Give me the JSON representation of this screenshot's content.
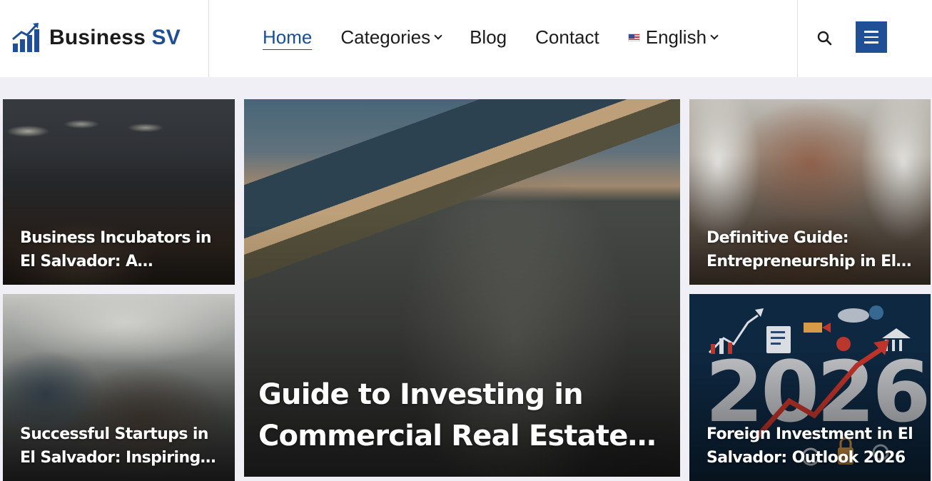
{
  "site": {
    "name_main": "Business",
    "name_accent": "SV"
  },
  "nav": {
    "home": "Home",
    "categories": "Categories",
    "blog": "Blog",
    "contact": "Contact",
    "language": "English"
  },
  "articles": {
    "left_top": {
      "title": "Business Incubators in El Salvador: A Complete Guide"
    },
    "left_bottom": {
      "title": "Successful Startups in El Salvador: Inspiring Stories"
    },
    "featured": {
      "title": "Guide to Investing in Commercial Real Estate in El Salvador"
    },
    "right_top": {
      "title": "Definitive Guide: Entrepreneurship in El Salvador"
    },
    "right_bottom": {
      "title": "Foreign Investment in El Salvador: Outlook 2026",
      "image_text": "2026"
    }
  },
  "colors": {
    "brand": "#1e4f97",
    "nav_active": "#1a4f97",
    "page_bg": "#efeff5"
  },
  "icons": [
    "bar-chart-logo-icon",
    "chevron-down-icon",
    "us-flag-icon",
    "search-icon",
    "hamburger-menu-icon"
  ]
}
